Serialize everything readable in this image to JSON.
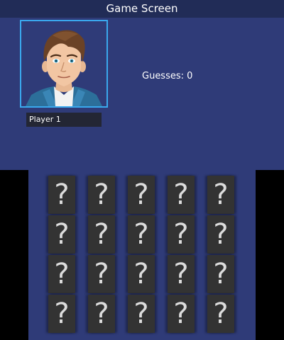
{
  "header": {
    "title": "Game Screen"
  },
  "player": {
    "name": "Player 1",
    "avatar_icon": "male-player-avatar"
  },
  "stats": {
    "guesses_text": "Guesses: 0"
  },
  "board": {
    "rows": 4,
    "columns": 5,
    "card_face": "?",
    "cards": [
      "?",
      "?",
      "?",
      "?",
      "?",
      "?",
      "?",
      "?",
      "?",
      "?",
      "?",
      "?",
      "?",
      "?",
      "?",
      "?",
      "?",
      "?",
      "?",
      "?"
    ]
  },
  "colors": {
    "panel": "#2f3b78",
    "title_bar": "#212c57",
    "avatar_border": "#3aa8ee",
    "card": "#333333"
  }
}
